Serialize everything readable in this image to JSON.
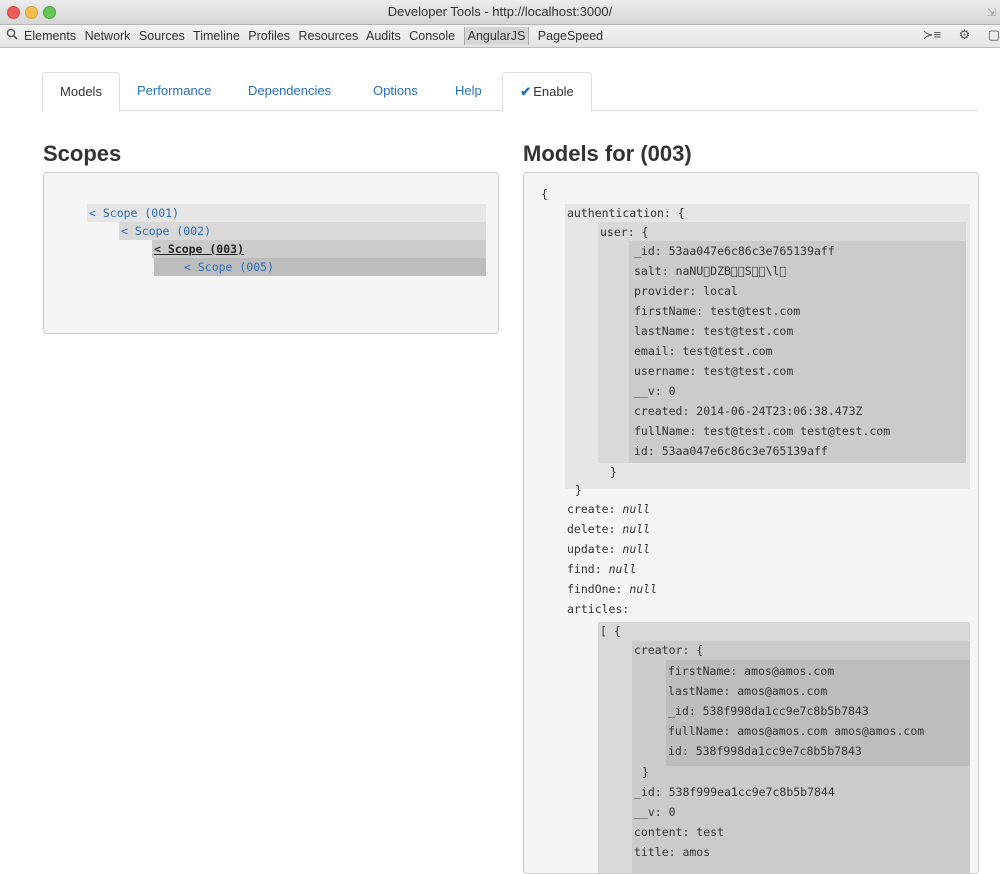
{
  "window": {
    "title": "Developer Tools - http://localhost:3000/"
  },
  "devtools": {
    "tabs": [
      "Elements",
      "Network",
      "Sources",
      "Timeline",
      "Profiles",
      "Resources",
      "Audits",
      "Console",
      "AngularJS",
      "PageSpeed"
    ],
    "active_tab": "AngularJS"
  },
  "panel_tabs": {
    "models": "Models",
    "performance": "Performance",
    "dependencies": "Dependencies",
    "options": "Options",
    "help": "Help",
    "enable": "Enable",
    "enable_checked": true
  },
  "scopes": {
    "heading": "Scopes",
    "items": [
      "< Scope (001)",
      "< Scope (002)",
      "< Scope (003)",
      "< Scope (005)"
    ],
    "selected": "< Scope (003)"
  },
  "models": {
    "heading": "Models for (003)",
    "open_brace": "{",
    "authentication_key": "authentication:  {",
    "user_key": "user:  {",
    "user_fields": [
      "_id: 53aa047e6c86c3e765139aff",
      "salt: naNU\u0000DZB\u0000\u0000S\u0000\u0000\\l\u0000",
      "provider: local",
      "firstName: test@test.com",
      "lastName: test@test.com",
      "email: test@test.com",
      "username: test@test.com",
      "__v: 0",
      "created: 2014-06-24T23:06:38.473Z",
      "fullName: test@test.com test@test.com",
      "id: 53aa047e6c86c3e765139aff"
    ],
    "close_brace": "}",
    "null_fields": [
      {
        "key": "create:",
        "value": "null"
      },
      {
        "key": "delete:",
        "value": "null"
      },
      {
        "key": "update:",
        "value": "null"
      },
      {
        "key": "find:",
        "value": "null"
      },
      {
        "key": "findOne:",
        "value": "null"
      }
    ],
    "articles_key": "articles:",
    "array_open": "[  {",
    "creator_key": "creator:  {",
    "creator_fields": [
      "firstName: amos@amos.com",
      "lastName: amos@amos.com",
      "_id: 538f998da1cc9e7c8b5b7843",
      "fullName: amos@amos.com amos@amos.com",
      "id: 538f998da1cc9e7c8b5b7843"
    ],
    "article_fields": [
      "_id: 538f999ea1cc9e7c8b5b7844",
      "__v: 0",
      "content: test",
      "title: amos"
    ]
  }
}
